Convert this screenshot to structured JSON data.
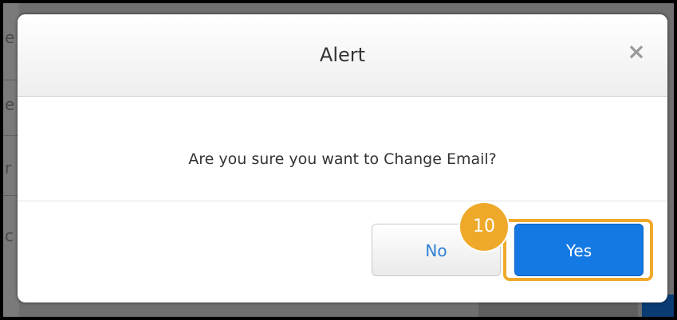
{
  "dialog": {
    "title": "Alert",
    "close_symbol": "×",
    "message": "Are you sure you want to Change Email?",
    "buttons": {
      "no_label": "No",
      "yes_label": "Yes"
    }
  },
  "annotation": {
    "step_number": "10",
    "highlight_color": "#efa92a"
  },
  "background_page": {
    "letters": [
      "e",
      "e",
      "r",
      "c"
    ]
  },
  "colors": {
    "primary_button": "#1479e3",
    "secondary_text": "#2f7fd6"
  }
}
